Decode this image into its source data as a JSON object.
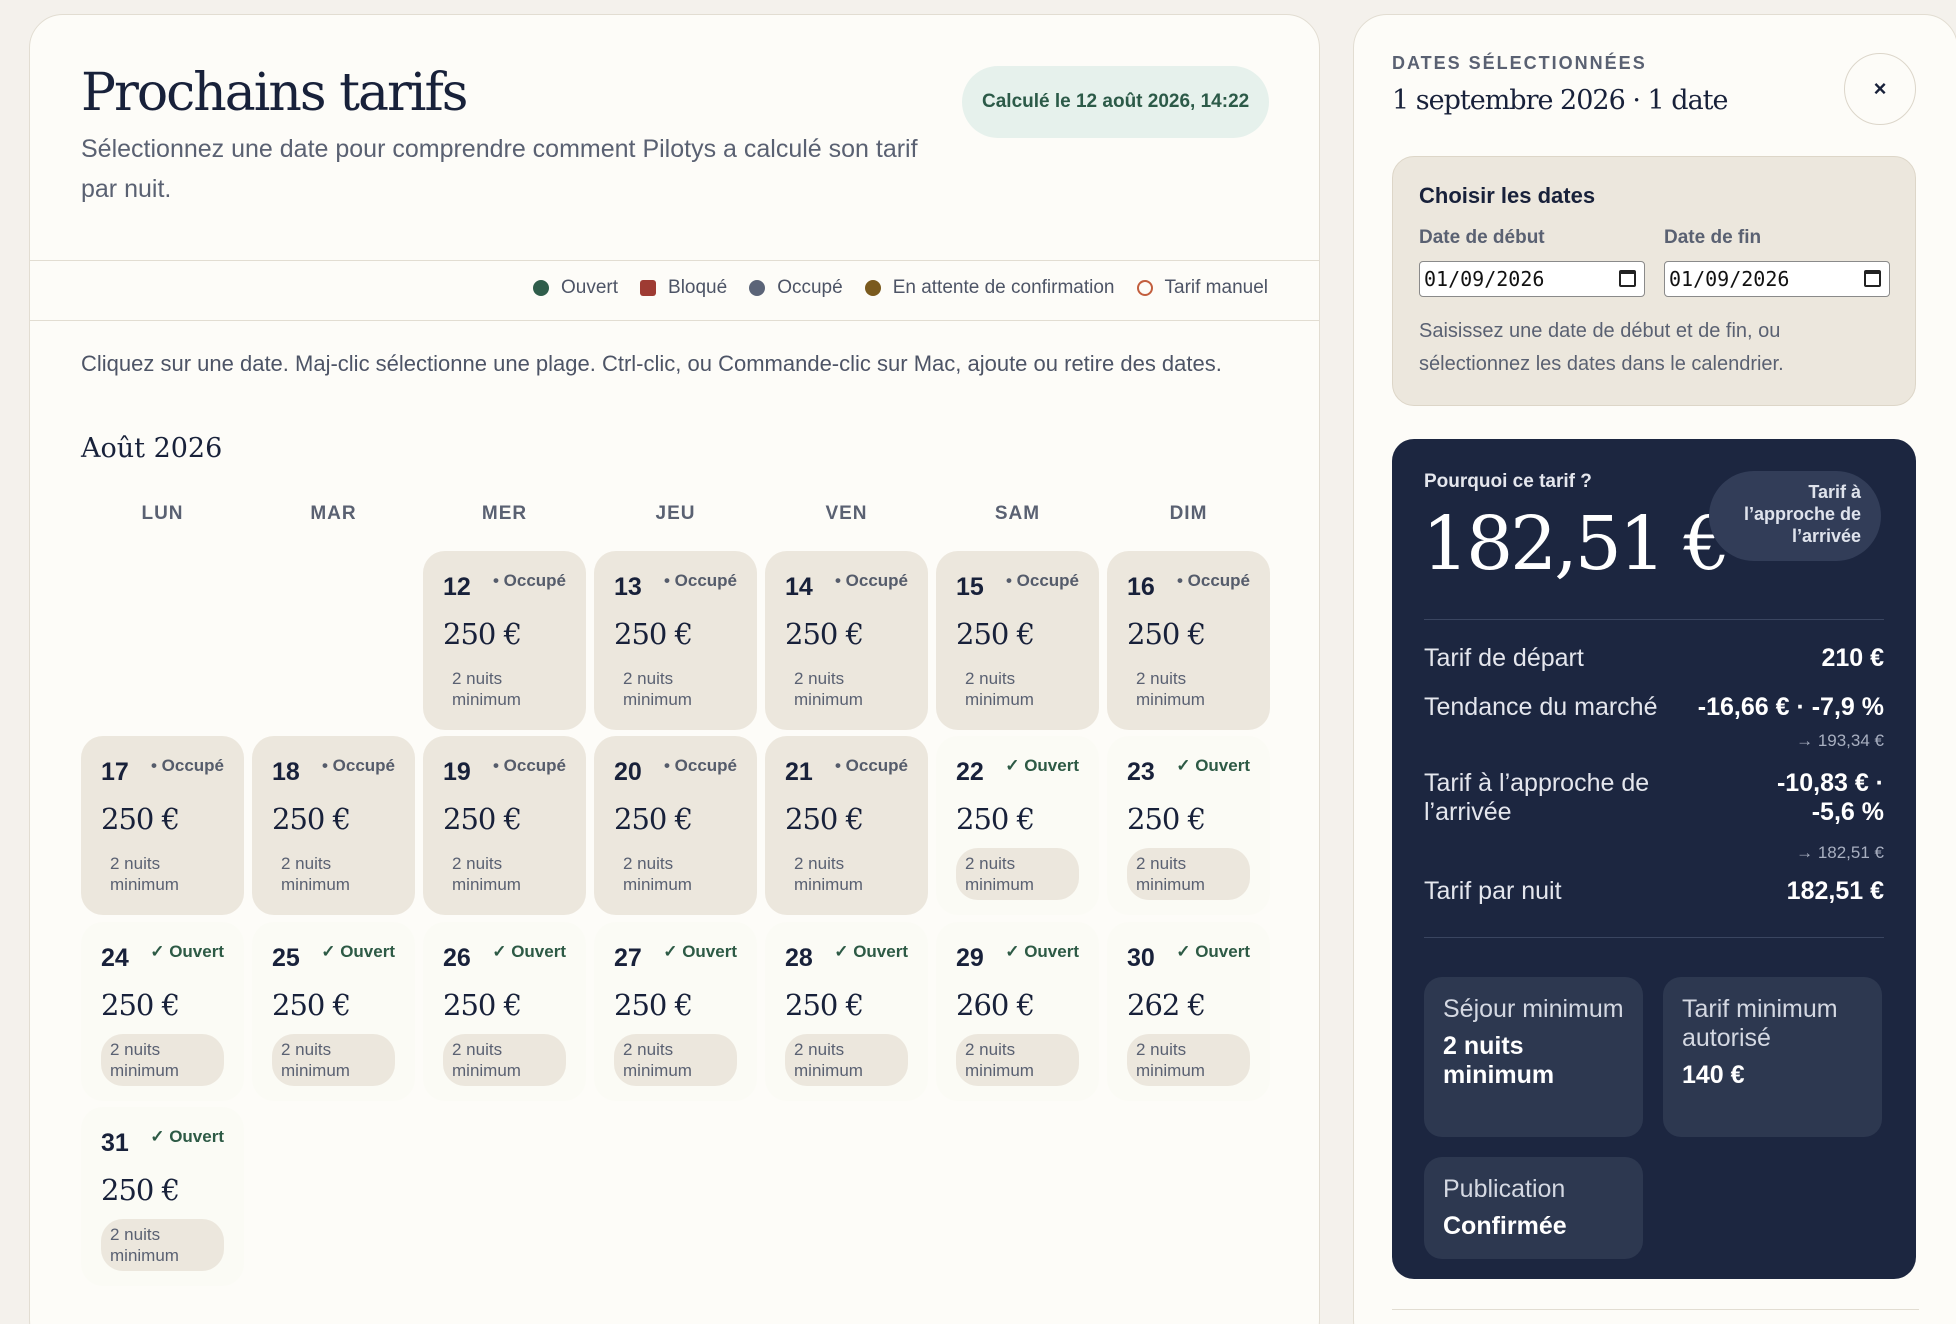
{
  "main": {
    "title": "Prochains tarifs",
    "subtitle": "Sélectionnez une date pour comprendre comment Pilotys a calculé son tarif par nuit.",
    "calculated_badge": "Calculé le 12 août 2026, 14:22",
    "legend": [
      {
        "label": "Ouvert",
        "shape": "dot",
        "color": "#2f5d4b"
      },
      {
        "label": "Bloqué",
        "shape": "square",
        "color": "#9e3b33"
      },
      {
        "label": "Occupé",
        "shape": "dot",
        "color": "#5b6478"
      },
      {
        "label": "En attente de confirmation",
        "shape": "dot",
        "color": "#7a5a1e"
      },
      {
        "label": "Tarif manuel",
        "shape": "ring",
        "color": "#c25e3e"
      }
    ],
    "instructions": "Cliquez sur une date. Maj-clic sélectionne une plage. Ctrl-clic, ou Commande-clic sur Mac, ajoute ou retire des dates.",
    "month_label": "Août 2026",
    "weekdays": [
      "LUN",
      "MAR",
      "MER",
      "JEU",
      "VEN",
      "SAM",
      "DIM"
    ],
    "days": [
      {
        "day": "12",
        "status": "• Occupé",
        "state": "occupied",
        "price": "250 €",
        "min": "2 nuits minimum"
      },
      {
        "day": "13",
        "status": "• Occupé",
        "state": "occupied",
        "price": "250 €",
        "min": "2 nuits minimum"
      },
      {
        "day": "14",
        "status": "• Occupé",
        "state": "occupied",
        "price": "250 €",
        "min": "2 nuits minimum"
      },
      {
        "day": "15",
        "status": "• Occupé",
        "state": "occupied",
        "price": "250 €",
        "min": "2 nuits minimum"
      },
      {
        "day": "16",
        "status": "• Occupé",
        "state": "occupied",
        "price": "250 €",
        "min": "2 nuits minimum"
      },
      {
        "day": "17",
        "status": "• Occupé",
        "state": "occupied",
        "price": "250 €",
        "min": "2 nuits minimum"
      },
      {
        "day": "18",
        "status": "• Occupé",
        "state": "occupied",
        "price": "250 €",
        "min": "2 nuits minimum"
      },
      {
        "day": "19",
        "status": "• Occupé",
        "state": "occupied",
        "price": "250 €",
        "min": "2 nuits minimum"
      },
      {
        "day": "20",
        "status": "• Occupé",
        "state": "occupied",
        "price": "250 €",
        "min": "2 nuits minimum"
      },
      {
        "day": "21",
        "status": "• Occupé",
        "state": "occupied",
        "price": "250 €",
        "min": "2 nuits minimum"
      },
      {
        "day": "22",
        "status": "✓ Ouvert",
        "state": "open",
        "price": "250 €",
        "min": "2 nuits minimum"
      },
      {
        "day": "23",
        "status": "✓ Ouvert",
        "state": "open",
        "price": "250 €",
        "min": "2 nuits minimum"
      },
      {
        "day": "24",
        "status": "✓ Ouvert",
        "state": "open",
        "price": "250 €",
        "min": "2 nuits minimum"
      },
      {
        "day": "25",
        "status": "✓ Ouvert",
        "state": "open",
        "price": "250 €",
        "min": "2 nuits minimum"
      },
      {
        "day": "26",
        "status": "✓ Ouvert",
        "state": "open",
        "price": "250 €",
        "min": "2 nuits minimum"
      },
      {
        "day": "27",
        "status": "✓ Ouvert",
        "state": "open",
        "price": "250 €",
        "min": "2 nuits minimum"
      },
      {
        "day": "28",
        "status": "✓ Ouvert",
        "state": "open",
        "price": "250 €",
        "min": "2 nuits minimum"
      },
      {
        "day": "29",
        "status": "✓ Ouvert",
        "state": "open",
        "price": "260 €",
        "min": "2 nuits minimum"
      },
      {
        "day": "30",
        "status": "✓ Ouvert",
        "state": "open",
        "price": "262 €",
        "min": "2 nuits minimum"
      },
      {
        "day": "31",
        "status": "✓ Ouvert",
        "state": "open",
        "price": "250 €",
        "min": "2 nuits minimum"
      }
    ]
  },
  "side": {
    "label": "DATES SÉLECTIONNÉES",
    "date_summary": "1 septembre 2026 · 1 date",
    "close_glyph": "×",
    "choose": {
      "title": "Choisir les dates",
      "start_label": "Date de début",
      "start_value": "01/09/2026",
      "end_label": "Date de fin",
      "end_value": "01/09/2026",
      "help": "Saisissez une date de début et de fin, ou sélectionnez les dates dans le calendrier."
    },
    "why": {
      "label": "Pourquoi ce tarif ?",
      "price": "182,51 €",
      "badge": "Tarif à l’approche de l’arrivée",
      "rows": [
        {
          "label": "Tarif de départ",
          "value": "210 €",
          "sub": ""
        },
        {
          "label": "Tendance du marché",
          "value": "-16,66 € · -7,9 %",
          "sub": "→ 193,34 €"
        },
        {
          "label": "Tarif à l’approche de l’arrivée",
          "value": "-10,83 € · -5,6 %",
          "sub": "→ 182,51 €"
        },
        {
          "label": "Tarif par nuit",
          "value": "182,51 €",
          "sub": ""
        }
      ],
      "cards": [
        {
          "label": "Séjour minimum",
          "value": "2 nuits minimum"
        },
        {
          "label": "Tarif minimum autorisé",
          "value": "140 €"
        },
        {
          "label": "Publication",
          "value": "Confirmée"
        }
      ]
    }
  }
}
